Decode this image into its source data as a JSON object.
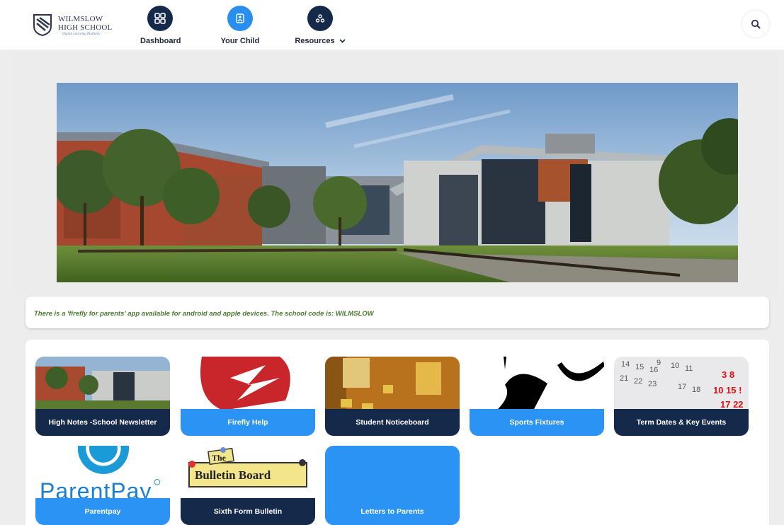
{
  "header": {
    "school_name_line1": "WILMSLOW",
    "school_name_line2": "HIGH SCHOOL",
    "school_tagline": "Digital Learning Platform",
    "nav": [
      {
        "label": "Dashboard",
        "icon": "grid-icon"
      },
      {
        "label": "Your Child",
        "icon": "child-icon"
      },
      {
        "label": "Resources",
        "icon": "resources-icon",
        "dropdown": true
      }
    ],
    "search_icon": "search-icon"
  },
  "notice": {
    "text": "There is a 'firefly for parents' app available for android and apple devices. The school code is: WILMSLOW"
  },
  "tiles": [
    {
      "label": "High Notes -School Newsletter"
    },
    {
      "label": "Firefly Help"
    },
    {
      "label": "Student Noticeboard"
    },
    {
      "label": "Sports Fixtures"
    },
    {
      "label": "Term Dates & Key Events"
    },
    {
      "label": "Parentpay",
      "logo_text": "ParentPay"
    },
    {
      "label": "Sixth Form Bulletin",
      "logo_text_1": "The",
      "logo_text_2": "Bulletin Board"
    },
    {
      "label": "Letters to Parents"
    }
  ],
  "colors": {
    "navy": "#15294a",
    "blue": "#2b93f3",
    "notice_green": "#4b7a2d"
  }
}
